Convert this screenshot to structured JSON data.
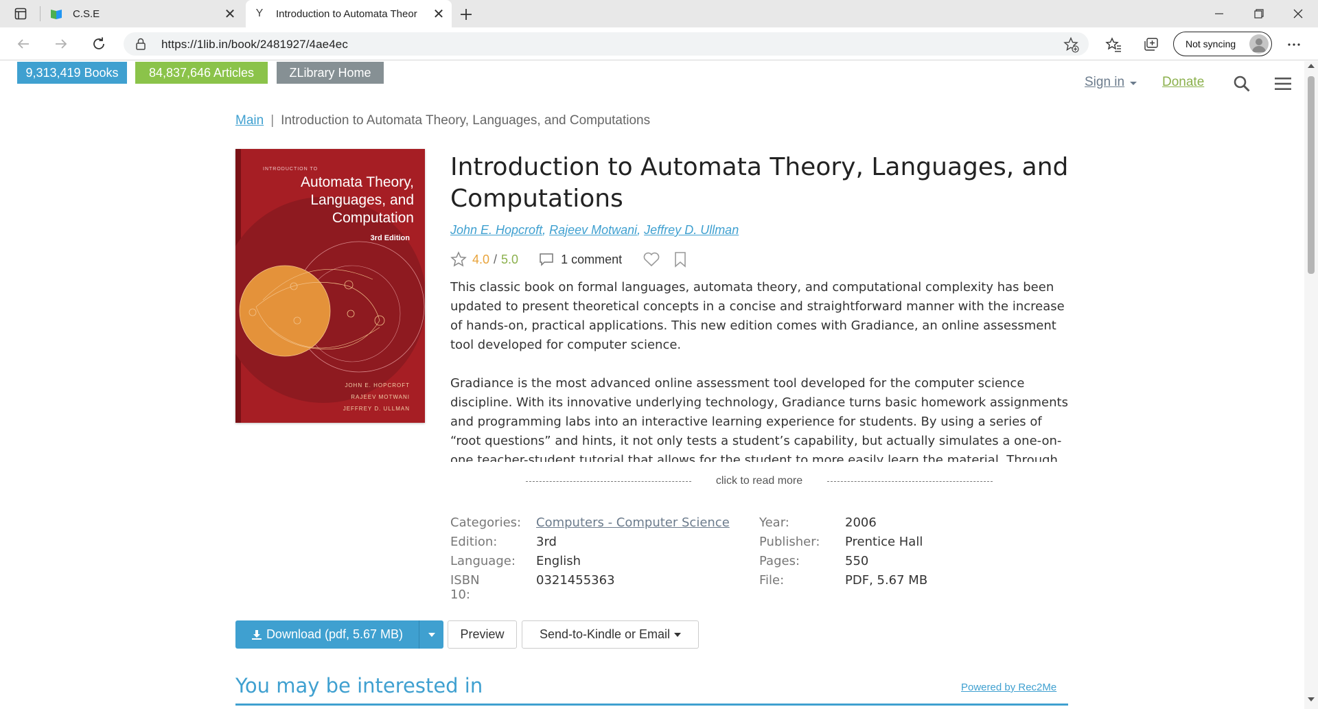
{
  "browser": {
    "tabs": [
      {
        "title": "C.S.E",
        "favicon": "book-favicon"
      },
      {
        "title": "Introduction to Automata Theor",
        "favicon": "y-favicon"
      }
    ],
    "address_url": "https://1lib.in/book/2481927/4ae4ec",
    "profile_label": "Not syncing"
  },
  "header": {
    "badges": {
      "books": "9,313,419 Books",
      "articles": "84,837,646 Articles",
      "home": "ZLibrary Home"
    },
    "signin": "Sign in",
    "donate": "Donate"
  },
  "breadcrumb": {
    "main": "Main",
    "separator": "|",
    "current": "Introduction to Automata Theory, Languages, and Computations"
  },
  "cover": {
    "top_text": "INTRODUCTION TO",
    "title_lines": [
      "Automata Theory,",
      "Languages, and",
      "Computation"
    ],
    "edition": "3rd Edition",
    "authors": [
      "JOHN E. HOPCROFT",
      "RAJEEV MOTWANI",
      "JEFFREY D. ULLMAN"
    ]
  },
  "book": {
    "title": "Introduction to Automata Theory, Languages, and Computations",
    "authors": [
      "John E. Hopcroft",
      "Rajeev Motwani",
      "Jeffrey D. Ullman"
    ],
    "rating": "4.0",
    "rating_sep": "/",
    "rating_max": "5.0",
    "comments": "1 comment",
    "description": [
      "This classic book on formal languages, automata theory, and computational complexity has been updated to present theoretical concepts in a concise and straightforward manner with the increase of hands-on, practical applications. This new edition comes with Gradiance, an online assessment tool developed for computer science.",
      "Gradiance is the most advanced online assessment tool developed for the computer science discipline. With its innovative underlying technology, Gradiance turns basic homework assignments and programming labs into an interactive learning experience for students. By using a series of “root questions” and hints, it not only tests a student’s capability, but actually simulates a one-on-one teacher-student tutorial that allows for the student to more easily learn the material. Through the"
    ],
    "read_more": "click to read more",
    "properties": {
      "categories_label": "Categories:",
      "categories_value": "Computers - Computer Science",
      "edition_label": "Edition:",
      "edition_value": "3rd",
      "language_label": "Language:",
      "language_value": "English",
      "isbn_label": "ISBN 10:",
      "isbn_value": "0321455363",
      "year_label": "Year:",
      "year_value": "2006",
      "publisher_label": "Publisher:",
      "publisher_value": "Prentice Hall",
      "pages_label": "Pages:",
      "pages_value": "550",
      "file_label": "File:",
      "file_value": "PDF, 5.67 MB"
    }
  },
  "actions": {
    "download": "Download (pdf, 5.67 MB)",
    "preview": "Preview",
    "kindle": "Send-to-Kindle or Email"
  },
  "recommend": {
    "title": "You may be interested in",
    "powered": "Powered by Rec2Me"
  },
  "colors": {
    "accent_blue": "#3fa0d0",
    "accent_green": "#8bc34a",
    "home_gray": "#869094",
    "cover_red": "#a61e24",
    "rating_orange": "#e8a33a"
  }
}
